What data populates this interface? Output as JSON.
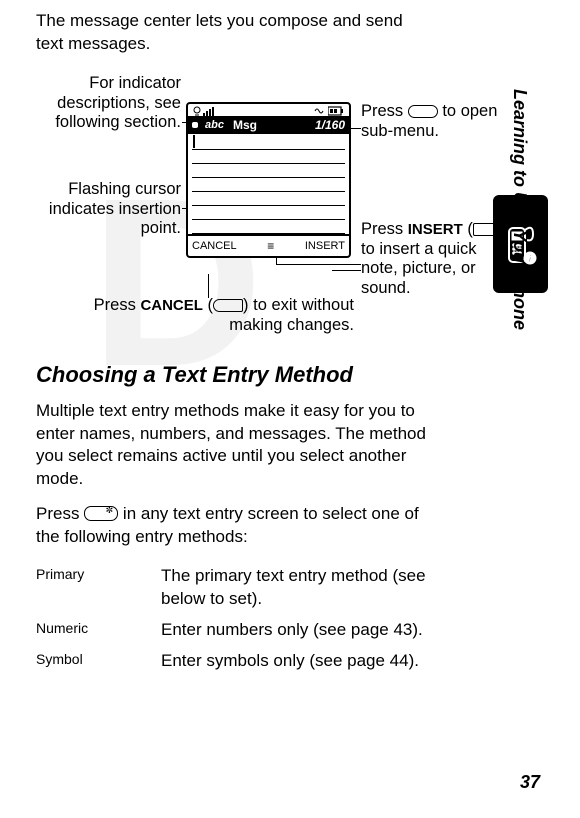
{
  "intro": "The message center lets you compose and send text messages.",
  "phone": {
    "abc": "abc",
    "title": "Msg",
    "counter": "1/160",
    "softkey_left": "CANCEL",
    "softkey_right": "INSERT",
    "menu_glyph": "≡"
  },
  "callouts": {
    "indicator": "For indicator descriptions, see following section.",
    "cursor": "Flashing cursor indicates insertion point.",
    "cancel_prefix": "Press ",
    "cancel_bold": "CANCEL",
    "cancel_mid": " (",
    "cancel_suffix": ") to exit without making changes.",
    "submenu_prefix": "Press ",
    "submenu_suffix": " to open sub-menu.",
    "insert_prefix": "Press ",
    "insert_bold": "INSERT",
    "insert_mid": " (",
    "insert_suffix": ") to insert a quick note, picture, or sound."
  },
  "heading": "Choosing a Text Entry Method",
  "para1": "Multiple text entry methods make it easy for you to enter names, numbers, and messages. The method you select remains active until you select another mode.",
  "para2_prefix": "Press ",
  "para2_suffix": " in any text entry screen to select one of the following entry methods:",
  "entries": [
    {
      "label": "Primary",
      "desc": "The primary text entry method (see below to set)."
    },
    {
      "label": "Numeric",
      "desc": "Enter numbers only (see page 43)."
    },
    {
      "label": "Symbol",
      "desc": "Enter symbols only (see page 44)."
    }
  ],
  "side_label": "Learning to Use Your Phone",
  "page_number": "37"
}
